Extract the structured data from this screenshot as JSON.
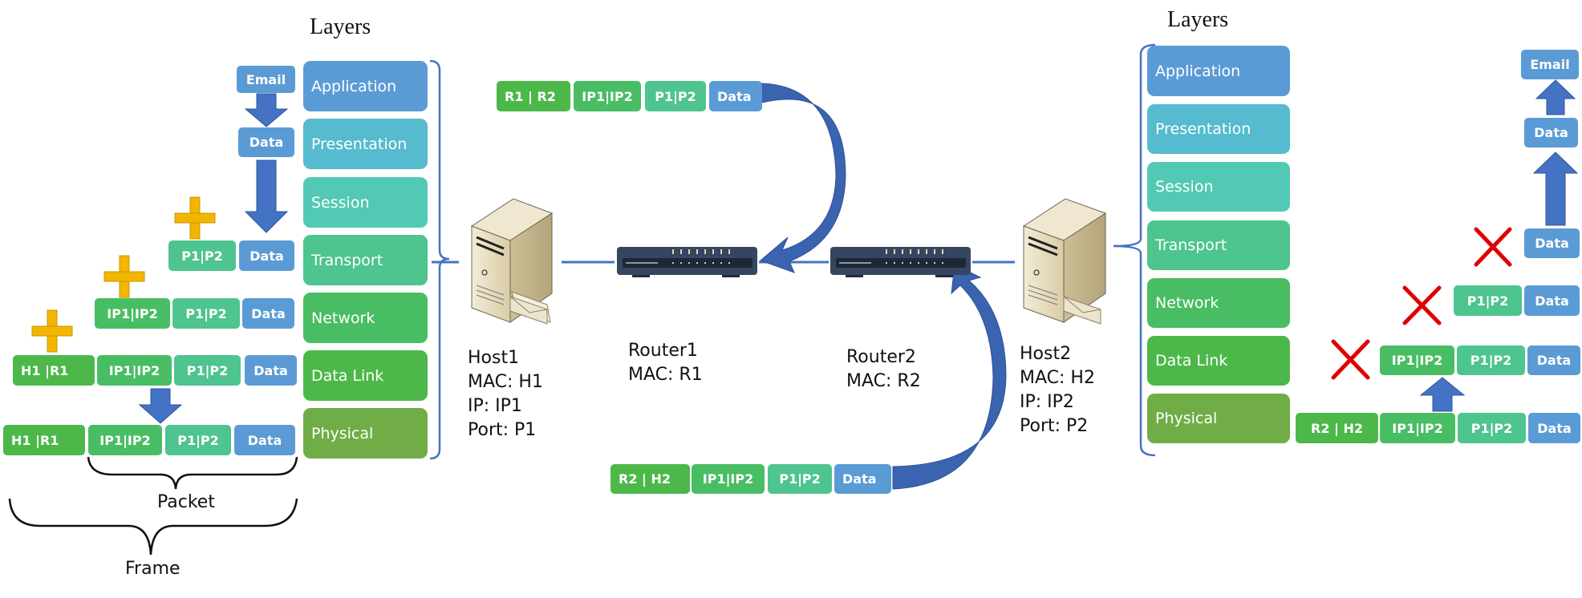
{
  "colors": {
    "application": "#5B9BD5",
    "presentation": "#56BBCE",
    "session": "#52C9B4",
    "transport": "#4EC48E",
    "network": "#49BD63",
    "data_link": "#4DB84A",
    "physical": "#70AD47",
    "data": "#5B9BD5",
    "port_header": "#4EC48E",
    "ip_header": "#49BD63",
    "mac_header": "#4DB84A",
    "arrow": "#4472C4",
    "arrow_dark": "#2F5597",
    "plus": "#F2B600",
    "cross": "#E00000",
    "brace": "#4472C4",
    "link_line": "#4472C4"
  },
  "left_stack": {
    "title": "Layers",
    "layers": [
      "Application",
      "Presentation",
      "Session",
      "Transport",
      "Network",
      "Data Link",
      "Physical"
    ]
  },
  "right_stack": {
    "title": "Layers",
    "layers": [
      "Application",
      "Presentation",
      "Session",
      "Transport",
      "Network",
      "Data Link",
      "Physical"
    ]
  },
  "encapsulation": {
    "email": "Email",
    "data": "Data",
    "transport_row": [
      "P1|P2",
      "Data"
    ],
    "network_row": [
      "IP1|IP2",
      "P1|P2",
      "Data"
    ],
    "datalink_row": [
      "H1 |R1",
      "IP1|IP2",
      "P1|P2",
      "Data"
    ],
    "physical_row": [
      "H1 |R1",
      "IP1|IP2",
      "P1|P2",
      "Data"
    ],
    "packet_label": "Packet",
    "frame_label": "Frame"
  },
  "decapsulation": {
    "email": "Email",
    "data": "Data",
    "transport_row": [
      "Data"
    ],
    "network_row": [
      "P1|P2",
      "Data"
    ],
    "datalink_row": [
      "IP1|IP2",
      "P1|P2",
      "Data"
    ],
    "physical_row": [
      "R2 | H2",
      "IP1|IP2",
      "P1|P2",
      "Data"
    ]
  },
  "transit": {
    "top_packet": [
      "R1 |  R2",
      "IP1|IP2",
      "P1|P2",
      "Data"
    ],
    "bottom_packet": [
      "R2 | H2",
      "IP1|IP2",
      "P1|P2",
      "Data"
    ]
  },
  "nodes": {
    "host1": {
      "name": "Host1",
      "mac": "MAC: H1",
      "ip": "IP: IP1",
      "port": "Port: P1",
      "icon": "server-icon"
    },
    "router1": {
      "name": "Router1",
      "mac": "MAC: R1",
      "icon": "router-icon"
    },
    "router2": {
      "name": "Router2",
      "mac": "MAC: R2",
      "icon": "router-icon"
    },
    "host2": {
      "name": "Host2",
      "mac": "MAC: H2",
      "ip": "IP: IP2",
      "port": "Port: P2",
      "icon": "server-icon"
    }
  }
}
